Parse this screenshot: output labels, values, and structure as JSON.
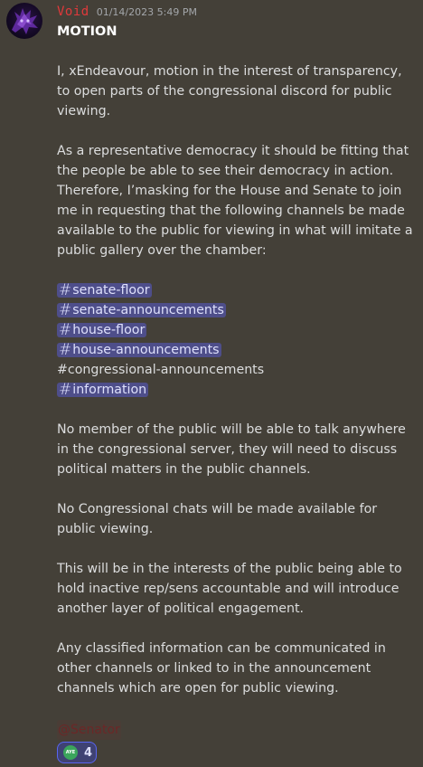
{
  "message": {
    "author": "Void",
    "timestamp": "01/14/2023 5:49 PM",
    "title": "MOTION",
    "paragraphs_before": [
      "I, xEndeavour, motion in the interest of transparency, to open parts of the congressional discord for public viewing.",
      "As a representative democracy it should be fitting that the people be able to see their democracy in action. Therefore, I’masking for the House and Senate to join me in requesting that the following channels be made available to the public for viewing in what will imitate a public gallery over the chamber:"
    ],
    "channels": [
      {
        "hash": "#",
        "name": "senate-floor",
        "linked": true
      },
      {
        "hash": "#",
        "name": "senate-announcements",
        "linked": true
      },
      {
        "hash": "#",
        "name": "house-floor",
        "linked": true
      },
      {
        "hash": "#",
        "name": "house-announcements",
        "linked": true
      },
      {
        "hash": "#",
        "name": "congressional-announcements",
        "linked": false
      },
      {
        "hash": "#",
        "name": "information",
        "linked": true
      }
    ],
    "paragraphs_after": [
      "No member of the public will be able to talk anywhere in the congressional server, they will need to discuss political matters in the public channels.",
      "No Congressional chats will be made available for public viewing.",
      "This will be in the interests of the public being able to hold inactive rep/sens accountable and will introduce another layer of political engagement.",
      "Any classified information can be communicated in other channels or linked to in the announcement channels which are open for public viewing."
    ],
    "role_mention": "@Senator"
  },
  "reaction": {
    "emoji_text": "AYE",
    "count": "4"
  },
  "colors": {
    "background": "#444038",
    "author": "#e0393b",
    "mention_bg": "#4e4e8a",
    "reaction_border": "#5865f2",
    "emoji": "#3ba55c"
  },
  "icons": {
    "avatar": "purple-spiky-creature-avatar",
    "reaction": "aye-vote-icon"
  }
}
